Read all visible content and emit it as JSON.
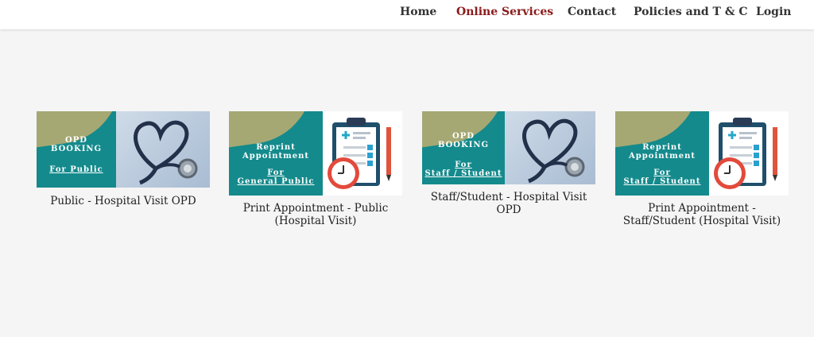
{
  "nav": {
    "items": [
      {
        "label": "Home"
      },
      {
        "label": "Online Services",
        "active": true
      },
      {
        "label": "Contact"
      },
      {
        "label": "Policies and T & C"
      },
      {
        "label": "Login"
      }
    ]
  },
  "colors": {
    "teal": "#148a8c",
    "olive": "#a5a873",
    "active_nav": "#8b1a1a"
  },
  "cards": [
    {
      "banner_title_1": "OPD",
      "banner_title_2": "BOOKING",
      "banner_sub_1": "For Public",
      "banner_sub_2": "",
      "image_icon": "stethoscope-heart-icon",
      "caption_1": "Public - Hospital Visit OPD",
      "caption_2": ""
    },
    {
      "banner_title_1": "Reprint",
      "banner_title_2": "Appointment",
      "banner_sub_1": "For",
      "banner_sub_2": "General Public",
      "image_icon": "clipboard-clock-icon",
      "caption_1": "Print Appointment - Public",
      "caption_2": "(Hospital Visit)"
    },
    {
      "banner_title_1": "OPD",
      "banner_title_2": "BOOKING",
      "banner_sub_1": "For",
      "banner_sub_2": "Staff / Student",
      "image_icon": "stethoscope-heart-icon",
      "caption_1": "Staff/Student - Hospital Visit",
      "caption_2": "OPD"
    },
    {
      "banner_title_1": "Reprint",
      "banner_title_2": "Appointment",
      "banner_sub_1": "For",
      "banner_sub_2": "Staff / Student",
      "image_icon": "clipboard-clock-icon",
      "caption_1": "Print Appointment -",
      "caption_2": "Staff/Student (Hospital Visit)"
    }
  ]
}
